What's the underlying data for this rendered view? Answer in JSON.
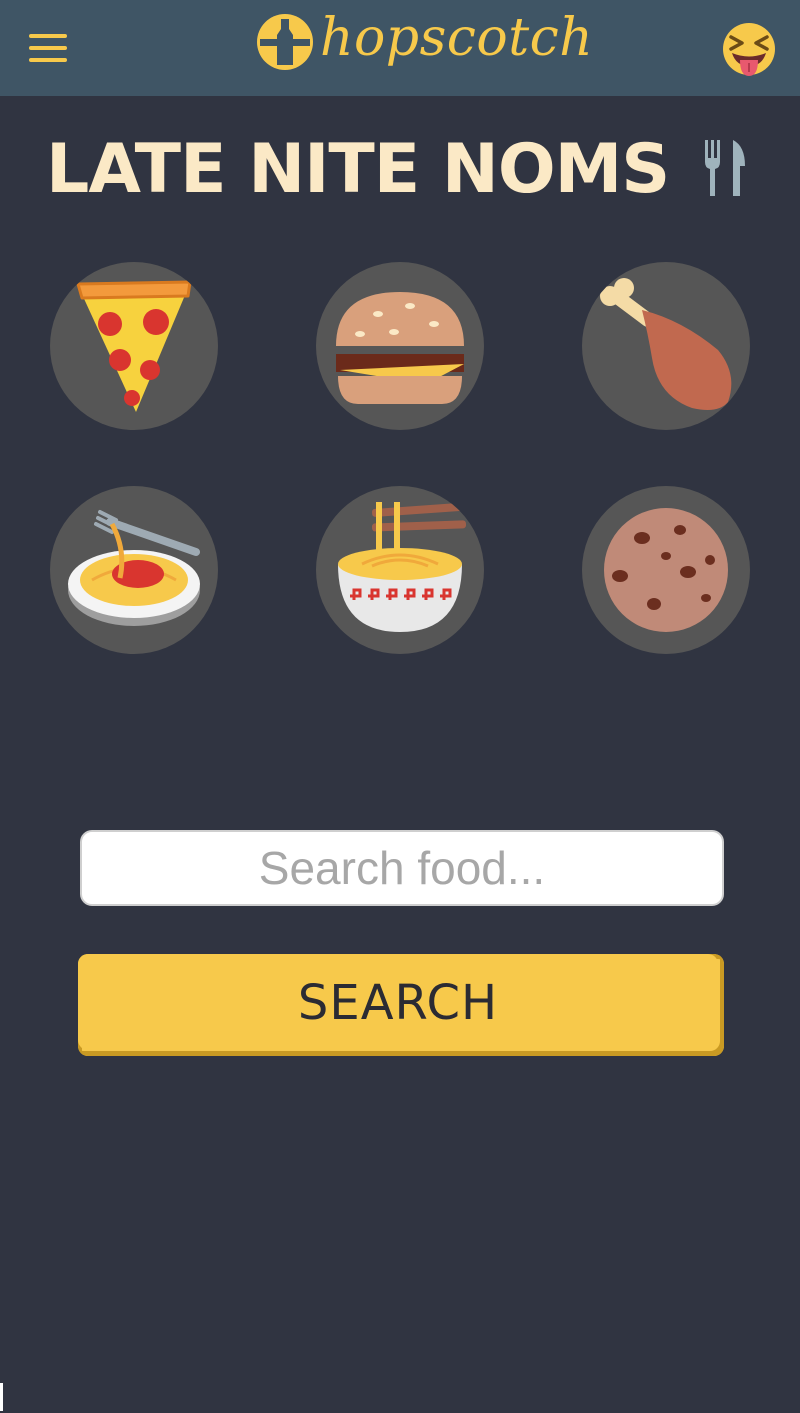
{
  "header": {
    "brand": "hopscotch",
    "menu_icon": "hamburger-menu-icon",
    "profile_icon": "squinting-tongue-emoji-icon"
  },
  "main": {
    "title": "LATE NITE NOMS",
    "title_icon": "fork-and-knife-icon",
    "foods": [
      {
        "name": "pizza",
        "icon": "pizza-icon"
      },
      {
        "name": "hamburger",
        "icon": "hamburger-icon"
      },
      {
        "name": "chicken leg",
        "icon": "chicken-leg-icon"
      },
      {
        "name": "spaghetti",
        "icon": "spaghetti-icon"
      },
      {
        "name": "ramen",
        "icon": "ramen-icon"
      },
      {
        "name": "cookie",
        "icon": "cookie-icon"
      }
    ]
  },
  "search": {
    "placeholder": "Search food...",
    "value": "",
    "button_label": "SEARCH"
  },
  "colors": {
    "background": "#303441",
    "header": "#3f5565",
    "accent": "#f7c94b",
    "title": "#fbe9c6",
    "food_circle": "#565656"
  }
}
